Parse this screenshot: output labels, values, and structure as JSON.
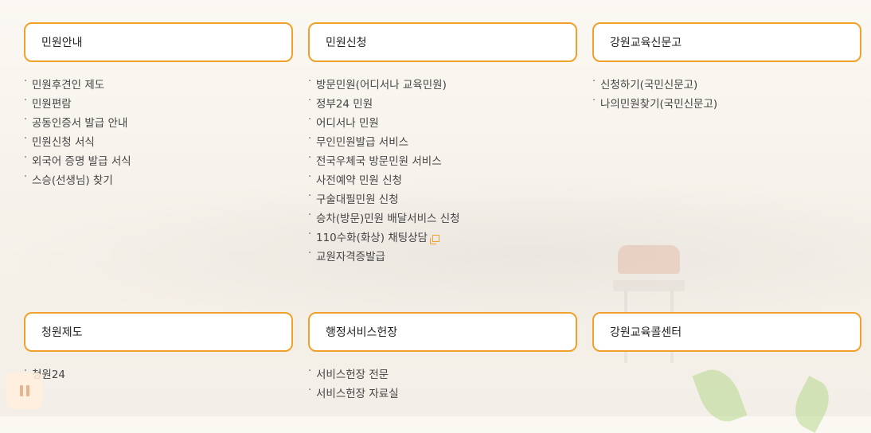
{
  "sections": [
    {
      "title": "민원안내",
      "items": [
        "민원후견인 제도",
        "민원편람",
        "공동인증서 발급 안내",
        "민원신청 서식",
        "외국어 증명 발급 서식",
        "스승(선생님) 찾기"
      ]
    },
    {
      "title": "민원신청",
      "items": [
        "방문민원(어디서나 교육민원)",
        "정부24 민원",
        "어디서나 민원",
        "무인민원발급 서비스",
        "전국우체국 방문민원 서비스",
        "사전예약 민원 신청",
        "구술대필민원 신청",
        "승차(방문)민원 배달서비스 신청",
        "110수화(화상) 채팅상담",
        "교원자격증발급"
      ]
    },
    {
      "title": "강원교육신문고",
      "items": [
        "신청하기(국민신문고)",
        "나의민원찾기(국민신문고)"
      ]
    },
    {
      "title": "청원제도",
      "items": [
        "청원24"
      ]
    },
    {
      "title": "행정서비스헌장",
      "items": [
        "서비스헌장 전문",
        "서비스헌장 자료실"
      ]
    },
    {
      "title": "강원교육콜센터",
      "items": []
    }
  ],
  "icons": {
    "external_link": "external-link-icon",
    "pause": "pause-icon"
  },
  "colors": {
    "accent": "#f0a12b",
    "text": "#444444"
  }
}
